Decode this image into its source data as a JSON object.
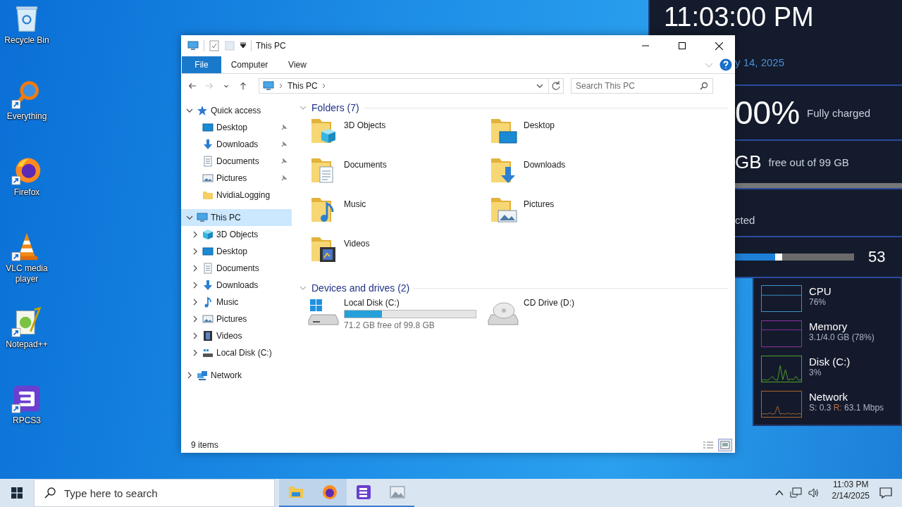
{
  "desktop_icons": [
    {
      "label": "Recycle Bin",
      "kind": "recycle",
      "shortcut": false
    },
    {
      "label": "Everything",
      "kind": "everything",
      "shortcut": true
    },
    {
      "label": "Firefox",
      "kind": "firefox",
      "shortcut": true
    },
    {
      "label": "VLC media player",
      "kind": "vlc",
      "shortcut": true
    },
    {
      "label": "Notepad++",
      "kind": "notepad",
      "shortcut": true
    },
    {
      "label": "RPCS3",
      "kind": "rpcs3",
      "shortcut": true
    }
  ],
  "widget": {
    "clock": "11:03:00 PM",
    "date": "y 14, 2025",
    "battery": "00%",
    "battery_status": "Fully charged",
    "storage": "GB",
    "storage_detail": "free out of 99 GB",
    "network": "cted",
    "volume": {
      "level": 0.34,
      "reading": "53"
    }
  },
  "performance": [
    {
      "name": "CPU",
      "reading": "76%",
      "kind": "cpu",
      "color": "#3d8fc9"
    },
    {
      "name": "Memory",
      "reading": "3.1/4.0 GB (78%)",
      "kind": "memory",
      "color": "#8e2fa3"
    },
    {
      "name": "Disk (C:)",
      "reading": "3%",
      "kind": "disk",
      "color": "#4ea12a"
    },
    {
      "name": "Network",
      "kind": "network",
      "color": "#a8652c",
      "sent": "S: 0.3",
      "received_label": "R:",
      "received": "63.1 Mbps"
    }
  ],
  "explorer": {
    "title": "This PC",
    "ribbon_tabs": [
      {
        "label": "File",
        "selected": true
      },
      {
        "label": "Computer",
        "selected": false
      },
      {
        "label": "View",
        "selected": false
      }
    ],
    "nav_buttons": [
      {
        "kind": "back",
        "disabled": false
      },
      {
        "kind": "forward",
        "disabled": true
      },
      {
        "kind": "recent",
        "disabled": false
      },
      {
        "kind": "up",
        "disabled": false
      }
    ],
    "address": {
      "path": "This PC"
    },
    "search": {
      "placeholder": "Search This PC"
    },
    "nav": [
      {
        "label": "Quick access",
        "kind": "star",
        "expanded": true,
        "selected": false,
        "children": [
          {
            "label": "Desktop",
            "kind": "desktop",
            "pinned": true,
            "selected": false
          },
          {
            "label": "Downloads",
            "kind": "downloads",
            "pinned": true,
            "selected": false
          },
          {
            "label": "Documents",
            "kind": "documents",
            "pinned": true,
            "selected": false
          },
          {
            "label": "Pictures",
            "kind": "pictures",
            "pinned": true,
            "selected": false
          },
          {
            "label": "NvidiaLogging",
            "kind": "folder",
            "pinned": false,
            "selected": false
          }
        ]
      },
      {
        "label": "This PC",
        "kind": "pc",
        "expanded": true,
        "selected": true,
        "children": [
          {
            "label": "3D Objects",
            "kind": "cube",
            "expanded": false,
            "selected": false
          },
          {
            "label": "Desktop",
            "kind": "desktop",
            "expanded": false,
            "selected": false
          },
          {
            "label": "Documents",
            "kind": "documents",
            "expanded": false,
            "selected": false
          },
          {
            "label": "Downloads",
            "kind": "downloads",
            "expanded": false,
            "selected": false
          },
          {
            "label": "Music",
            "kind": "music",
            "expanded": false,
            "selected": false
          },
          {
            "label": "Pictures",
            "kind": "pictures",
            "expanded": false,
            "selected": false
          },
          {
            "label": "Videos",
            "kind": "videos",
            "expanded": false,
            "selected": false
          },
          {
            "label": "Local Disk (C:)",
            "kind": "disk",
            "expanded": false,
            "selected": false
          }
        ]
      },
      {
        "label": "Network",
        "kind": "network",
        "expanded": false,
        "selected": false
      }
    ],
    "sections": [
      {
        "heading": "Folders (7)",
        "expanded": true,
        "items": [
          {
            "label": "3D Objects",
            "kind": "cube"
          },
          {
            "label": "Desktop",
            "kind": "desktop"
          },
          {
            "label": "Documents",
            "kind": "documents"
          },
          {
            "label": "Downloads",
            "kind": "downloads"
          },
          {
            "label": "Music",
            "kind": "music"
          },
          {
            "label": "Pictures",
            "kind": "pictures"
          },
          {
            "label": "Videos",
            "kind": "videos"
          }
        ]
      },
      {
        "heading": "Devices and drives (2)",
        "expanded": true,
        "items": [
          {
            "label": "Local Disk (C:)",
            "kind": "disk",
            "level": 0.287,
            "free": "71.2 GB free of 99.8 GB"
          },
          {
            "label": "CD Drive (D:)",
            "kind": "cd"
          }
        ]
      }
    ],
    "status": "9 items",
    "views": [
      {
        "kind": "details",
        "selected": false
      },
      {
        "kind": "tiles",
        "selected": true
      }
    ]
  },
  "taskbar": {
    "search_placeholder": "Type here to search",
    "apps": [
      {
        "kind": "explorer",
        "active": true
      },
      {
        "kind": "firefox",
        "active": true
      },
      {
        "kind": "rpcs3",
        "active": false
      },
      {
        "kind": "photos",
        "active": false
      }
    ],
    "time": "11:03 PM",
    "date": "2/14/2025"
  }
}
